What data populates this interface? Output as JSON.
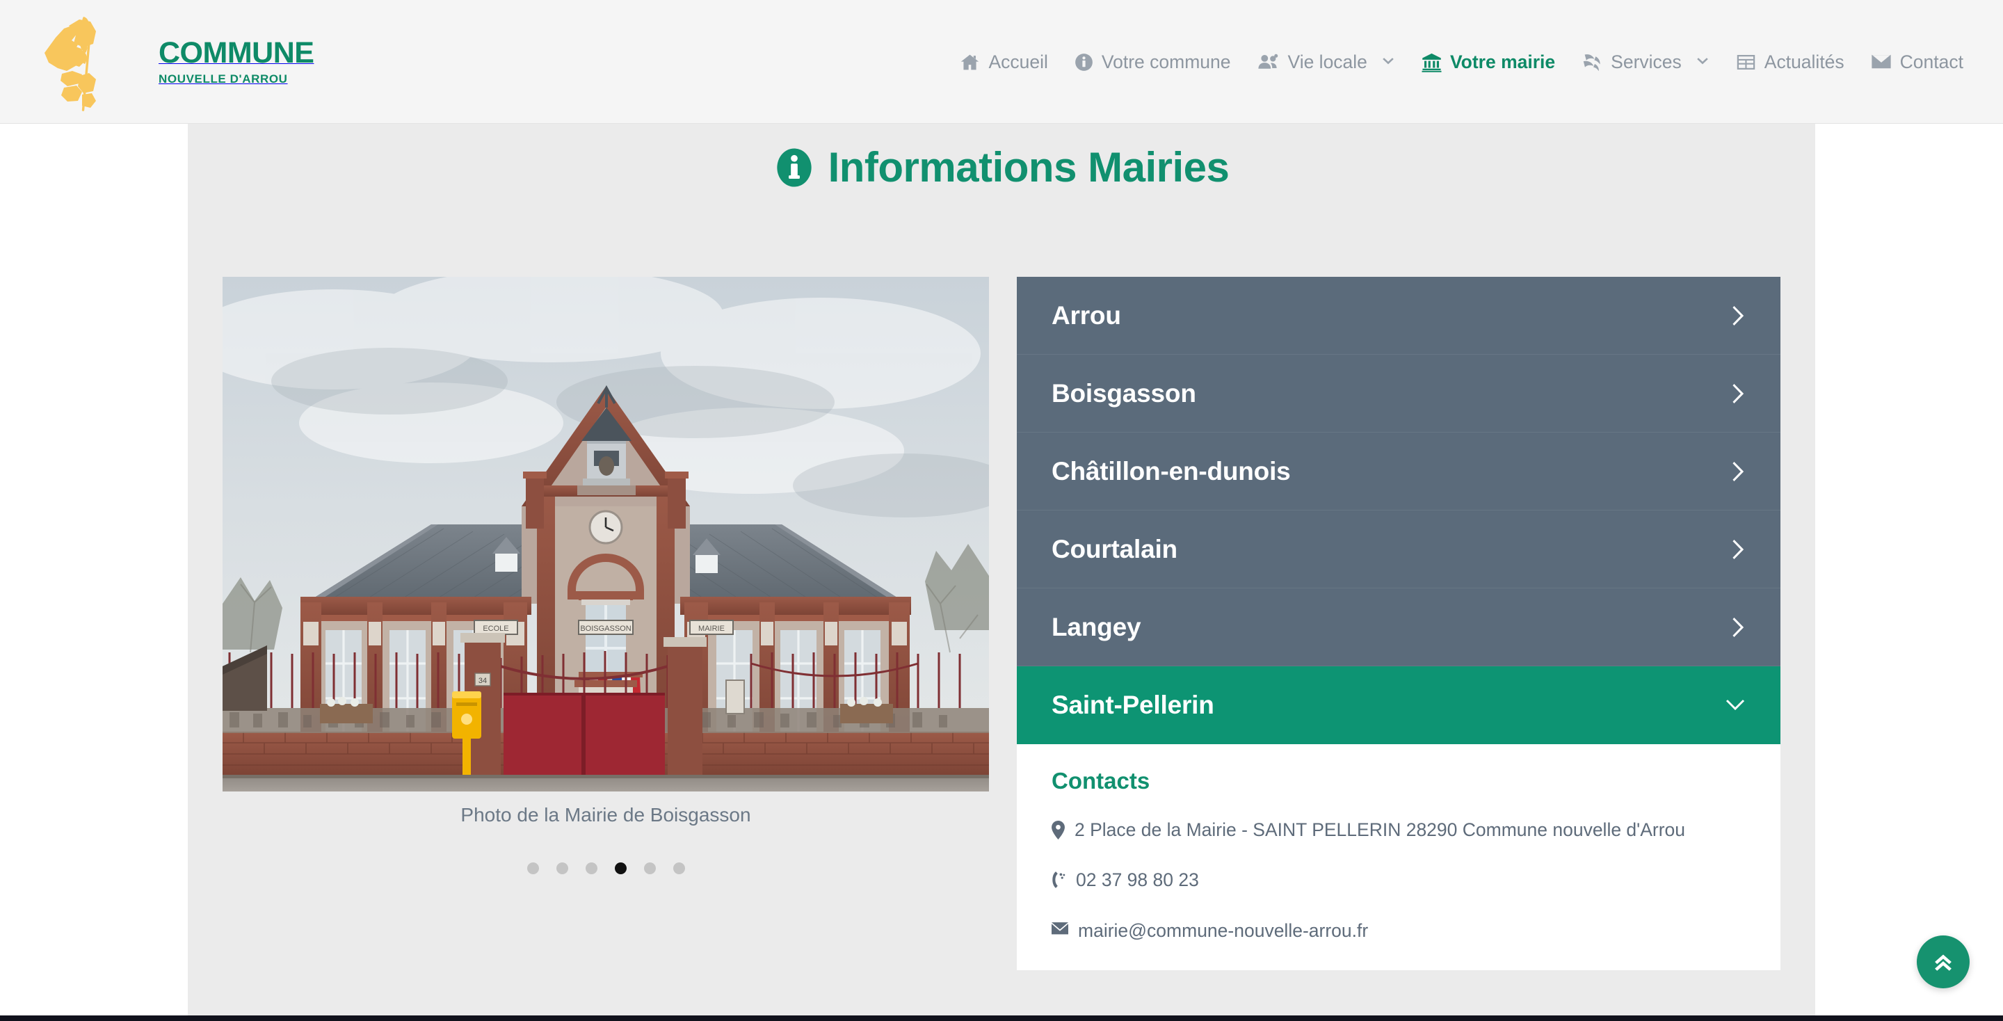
{
  "header": {
    "logo": {
      "title": "COMMUNE",
      "subtitle": "NOUVELLE D'ARROU",
      "icon": "commune-map-wheat-logo"
    },
    "nav": [
      {
        "label": "Accueil",
        "icon": "home-icon",
        "active": false,
        "has_caret": false
      },
      {
        "label": "Votre commune",
        "icon": "info-icon",
        "active": false,
        "has_caret": false
      },
      {
        "label": "Vie locale",
        "icon": "users-icon",
        "active": false,
        "has_caret": true
      },
      {
        "label": "Votre mairie",
        "icon": "bank-icon",
        "active": true,
        "has_caret": false
      },
      {
        "label": "Services",
        "icon": "layers-icon",
        "active": false,
        "has_caret": true
      },
      {
        "label": "Actualités",
        "icon": "news-icon",
        "active": false,
        "has_caret": false
      },
      {
        "label": "Contact",
        "icon": "envelope-icon",
        "active": false,
        "has_caret": false
      }
    ]
  },
  "page": {
    "title": "Informations Mairies",
    "title_icon": "info-circle-icon"
  },
  "carousel": {
    "caption": "Photo de la Mairie de Boisgasson",
    "slide_count": 6,
    "active_slide": 4,
    "image_alt": "Mairie et École de Boisgasson"
  },
  "accordion": {
    "items": [
      {
        "label": "Arrou",
        "open": false,
        "chevron": "chevron-right-icon"
      },
      {
        "label": "Boisgasson",
        "open": false,
        "chevron": "chevron-right-icon"
      },
      {
        "label": "Châtillon-en-dunois",
        "open": false,
        "chevron": "chevron-right-icon"
      },
      {
        "label": "Courtalain",
        "open": false,
        "chevron": "chevron-right-icon"
      },
      {
        "label": "Langey",
        "open": false,
        "chevron": "chevron-right-icon"
      },
      {
        "label": "Saint-Pellerin",
        "open": true,
        "chevron": "chevron-down-icon"
      }
    ],
    "open_panel": {
      "heading": "Contacts",
      "address": "2 Place de la Mairie - SAINT PELLERIN 28290 Commune nouvelle d'Arrou",
      "address_icon": "map-pin-icon",
      "phone": "02 37 98 80 23",
      "phone_icon": "phone-volume-icon",
      "email": "mairie@commune-nouvelle-arrou.fr",
      "email_icon": "envelope-icon"
    }
  },
  "scroll_top": {
    "label": "Remonter",
    "icon": "chevron-double-up-icon"
  },
  "colors": {
    "brand_green": "#11906f",
    "accent_green": "#0d9473",
    "slate": "#5b6b7b",
    "header_bg": "#f5f5f5",
    "canvas_bg": "#ebebeb",
    "nav_text": "#8d96a0",
    "logo_gold": "#f8c65c"
  }
}
